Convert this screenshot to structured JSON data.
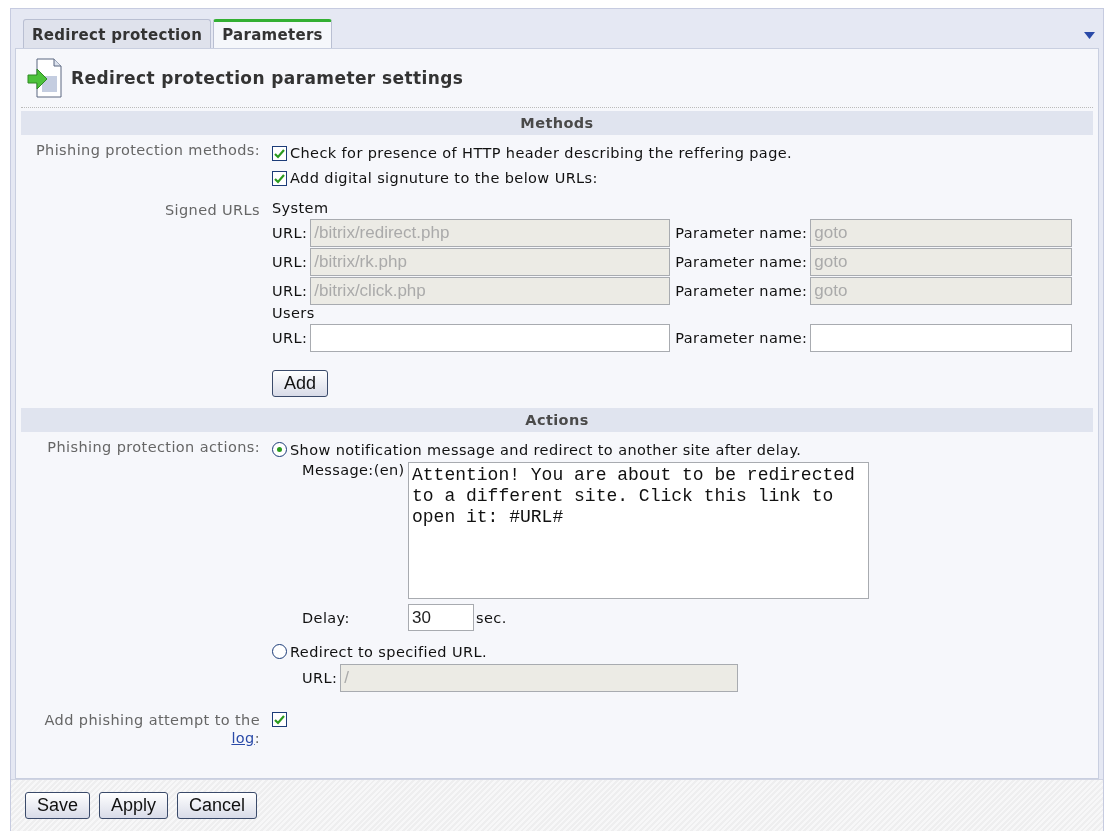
{
  "tabs": [
    {
      "label": "Redirect protection",
      "selected": false
    },
    {
      "label": "Parameters",
      "selected": true
    }
  ],
  "header": {
    "title": "Redirect protection parameter settings"
  },
  "methods": {
    "title": "Methods",
    "label": "Phishing protection methods:",
    "options": [
      {
        "label": "Check for presence of HTTP header describing the reffering page.",
        "checked": true
      },
      {
        "label": "Add digital signuture to the below URLs:",
        "checked": true
      }
    ],
    "signed_urls": {
      "label": "Signed URLs",
      "system_label": "System",
      "system_rows": [
        {
          "url_label": "URL:",
          "url": "/bitrix/redirect.php",
          "param_label": "Parameter name:",
          "param": "goto",
          "disabled": true
        },
        {
          "url_label": "URL:",
          "url": "/bitrix/rk.php",
          "param_label": "Parameter name:",
          "param": "goto",
          "disabled": true
        },
        {
          "url_label": "URL:",
          "url": "/bitrix/click.php",
          "param_label": "Parameter name:",
          "param": "goto",
          "disabled": true
        }
      ],
      "users_label": "Users",
      "user_rows": [
        {
          "url_label": "URL:",
          "param_label": "Parameter name:",
          "disabled": false
        }
      ],
      "add_button": "Add"
    }
  },
  "actions": {
    "title": "Actions",
    "label": "Phishing protection actions:",
    "options": [
      {
        "kind": "message",
        "label": "Show notification message and redirect to another site after delay.",
        "selected": true,
        "message_label": "Message:(en)",
        "message": "Attention! You are about to be redirected to a different site. Click this link to open it: #URL#",
        "delay_label": "Delay:",
        "delay": "30",
        "delay_unit": "sec."
      },
      {
        "kind": "url",
        "label": "Redirect to specified URL.",
        "selected": false,
        "url_label": "URL:",
        "url": "/",
        "disabled": true
      }
    ]
  },
  "log": {
    "text": "Add phishing attempt to the ",
    "link": "log",
    "after": ":",
    "checked": true
  },
  "buttons": [
    "Save",
    "Apply",
    "Cancel"
  ]
}
